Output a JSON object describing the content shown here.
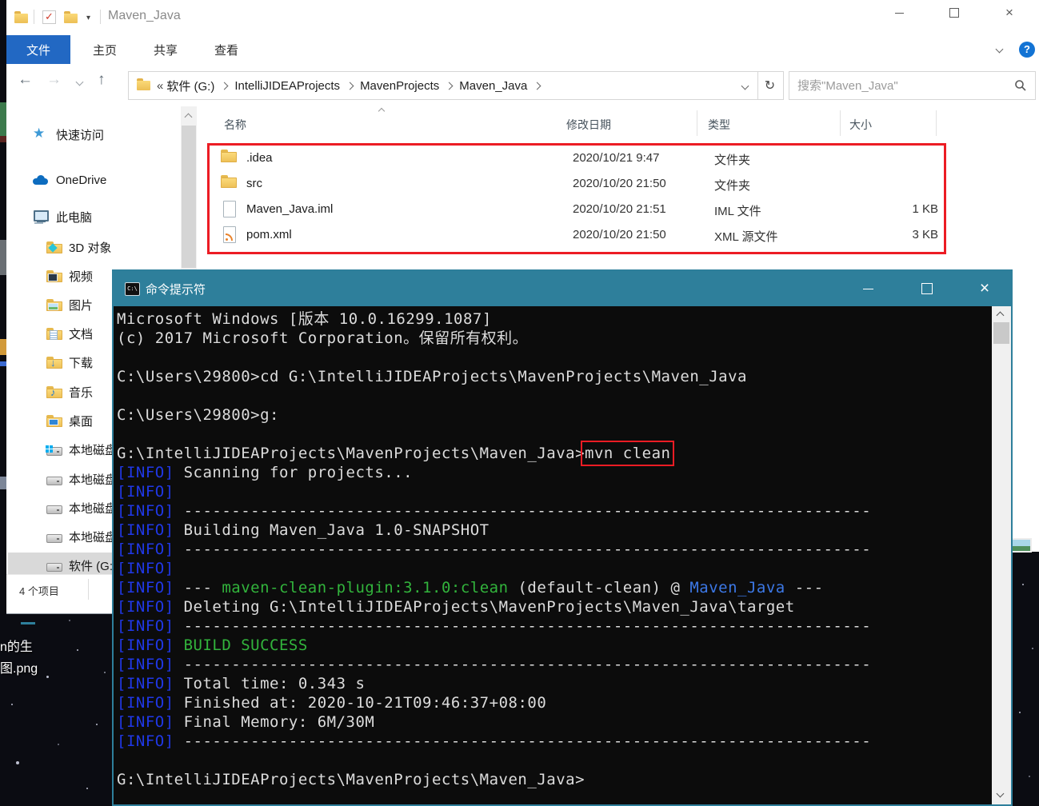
{
  "explorer": {
    "title": "Maven_Java",
    "tabs": {
      "file": "文件",
      "home": "主页",
      "share": "共享",
      "view": "查看"
    },
    "help_label": "?",
    "address": {
      "prefix": "«",
      "crumbs": [
        "软件 (G:)",
        "IntelliJIDEAProjects",
        "MavenProjects",
        "Maven_Java"
      ]
    },
    "search": {
      "placeholder": "搜索\"Maven_Java\""
    },
    "sidebar": {
      "items": [
        {
          "label": "快速访问",
          "icon": "ic-star",
          "indent": 0,
          "selected": false
        },
        {
          "label": "OneDrive",
          "icon": "ic-cloud",
          "indent": 0,
          "selected": false
        },
        {
          "label": "此电脑",
          "icon": "ic-pc",
          "indent": 0,
          "selected": false
        },
        {
          "label": "3D 对象",
          "icon": "fld fld-3d",
          "indent": 1,
          "selected": false
        },
        {
          "label": "视频",
          "icon": "fld fld-video",
          "indent": 1,
          "selected": false
        },
        {
          "label": "图片",
          "icon": "fld fld-pic",
          "indent": 1,
          "selected": false
        },
        {
          "label": "文档",
          "icon": "fld fld-doc",
          "indent": 1,
          "selected": false
        },
        {
          "label": "下载",
          "icon": "fld fld-down",
          "indent": 1,
          "selected": false
        },
        {
          "label": "音乐",
          "icon": "fld fld-music",
          "indent": 1,
          "selected": false
        },
        {
          "label": "桌面",
          "icon": "fld fld-desk",
          "indent": 1,
          "selected": false
        },
        {
          "label": "本地磁盘",
          "icon": "ic-disk disk-win",
          "indent": 1,
          "selected": false
        },
        {
          "label": "本地磁盘",
          "icon": "ic-disk",
          "indent": 1,
          "selected": false
        },
        {
          "label": "本地磁盘",
          "icon": "ic-disk",
          "indent": 1,
          "selected": false
        },
        {
          "label": "本地磁盘",
          "icon": "ic-disk",
          "indent": 1,
          "selected": false
        },
        {
          "label": "软件 (G:)",
          "icon": "ic-disk",
          "indent": 1,
          "selected": true
        }
      ]
    },
    "files": {
      "headers": {
        "name": "名称",
        "date": "修改日期",
        "type": "类型",
        "size": "大小"
      },
      "rows": [
        {
          "name": ".idea",
          "icon": "fi-folder",
          "date": "2020/10/21 9:47",
          "type": "文件夹",
          "size": ""
        },
        {
          "name": "src",
          "icon": "fi-folder",
          "date": "2020/10/20 21:50",
          "type": "文件夹",
          "size": ""
        },
        {
          "name": "Maven_Java.iml",
          "icon": "fi-page",
          "date": "2020/10/20 21:51",
          "type": "IML 文件",
          "size": "1 KB"
        },
        {
          "name": "pom.xml",
          "icon": "fi-xml",
          "date": "2020/10/20 21:50",
          "type": "XML 源文件",
          "size": "3 KB"
        }
      ]
    },
    "status": "4 个项目"
  },
  "cmd": {
    "title": "命令提示符",
    "icon_label": "C:\\",
    "lines": [
      [
        {
          "t": "Microsoft Windows [版本 10.0.16299.1087]",
          "c": "fg"
        }
      ],
      [
        {
          "t": "(c) 2017 Microsoft Corporation。保留所有权利。",
          "c": "fg"
        }
      ],
      [],
      [
        {
          "t": "C:\\Users\\29800>cd G:\\IntelliJIDEAProjects\\MavenProjects\\Maven_Java",
          "c": "fg"
        }
      ],
      [],
      [
        {
          "t": "C:\\Users\\29800>g:",
          "c": "fg"
        }
      ],
      [],
      [
        {
          "t": "G:\\IntelliJIDEAProjects\\MavenProjects\\Maven_Java>",
          "c": "fg"
        },
        {
          "t": "mvn clean",
          "c": "box"
        }
      ],
      [
        {
          "t": "[INFO] ",
          "c": "info"
        },
        {
          "t": "Scanning for projects...",
          "c": "fg"
        }
      ],
      [
        {
          "t": "[INFO]",
          "c": "info"
        }
      ],
      [
        {
          "t": "[INFO] ",
          "c": "info"
        },
        {
          "t": "------------------------------------------------------------------------",
          "c": "fg"
        }
      ],
      [
        {
          "t": "[INFO] ",
          "c": "info"
        },
        {
          "t": "Building Maven_Java 1.0-SNAPSHOT",
          "c": "fg"
        }
      ],
      [
        {
          "t": "[INFO] ",
          "c": "info"
        },
        {
          "t": "------------------------------------------------------------------------",
          "c": "fg"
        }
      ],
      [
        {
          "t": "[INFO]",
          "c": "info"
        }
      ],
      [
        {
          "t": "[INFO] ",
          "c": "info"
        },
        {
          "t": "--- ",
          "c": "fg"
        },
        {
          "t": "maven-clean-plugin:3.1.0:clean",
          "c": "grn"
        },
        {
          "t": " (default-clean) @ ",
          "c": "fg"
        },
        {
          "t": "Maven_Java",
          "c": "blu"
        },
        {
          "t": " ---",
          "c": "fg"
        }
      ],
      [
        {
          "t": "[INFO] ",
          "c": "info"
        },
        {
          "t": "Deleting G:\\IntelliJIDEAProjects\\MavenProjects\\Maven_Java\\target",
          "c": "fg"
        }
      ],
      [
        {
          "t": "[INFO] ",
          "c": "info"
        },
        {
          "t": "------------------------------------------------------------------------",
          "c": "fg"
        }
      ],
      [
        {
          "t": "[INFO] ",
          "c": "info"
        },
        {
          "t": "BUILD SUCCESS",
          "c": "grn"
        }
      ],
      [
        {
          "t": "[INFO] ",
          "c": "info"
        },
        {
          "t": "------------------------------------------------------------------------",
          "c": "fg"
        }
      ],
      [
        {
          "t": "[INFO] ",
          "c": "info"
        },
        {
          "t": "Total time: 0.343 s",
          "c": "fg"
        }
      ],
      [
        {
          "t": "[INFO] ",
          "c": "info"
        },
        {
          "t": "Finished at: 2020-10-21T09:46:37+08:00",
          "c": "fg"
        }
      ],
      [
        {
          "t": "[INFO] ",
          "c": "info"
        },
        {
          "t": "Final Memory: 6M/30M",
          "c": "fg"
        }
      ],
      [
        {
          "t": "[INFO] ",
          "c": "info"
        },
        {
          "t": "------------------------------------------------------------------------",
          "c": "fg"
        }
      ],
      [],
      [
        {
          "t": "G:\\IntelliJIDEAProjects\\MavenProjects\\Maven_Java>",
          "c": "fg"
        }
      ]
    ]
  },
  "desktop": {
    "icon_label_line1": "n的生",
    "icon_label_line2": "图.png"
  },
  "colors": {
    "cmd_titlebar": "#2e7f9b",
    "info_blue": "#2038e6",
    "maven_green": "#32b43c",
    "maven_blue": "#3c78e6",
    "annotation_red": "#ec1c24",
    "file_tab_blue": "#2268c3"
  }
}
